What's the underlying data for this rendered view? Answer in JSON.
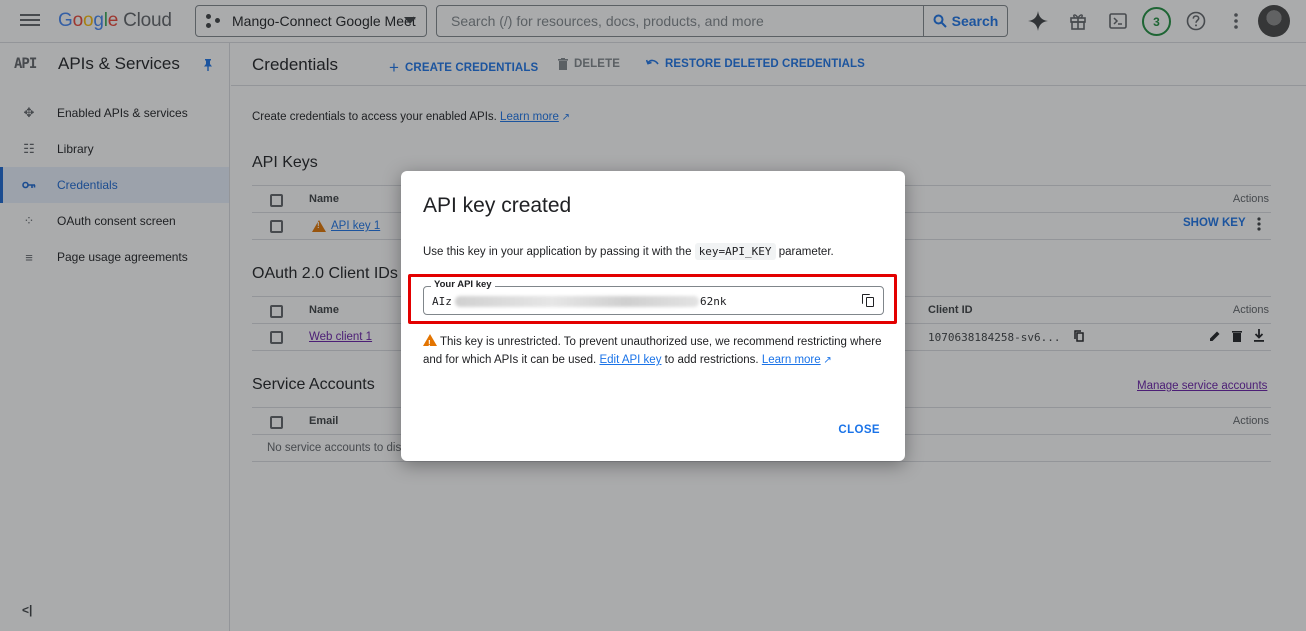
{
  "topbar": {
    "logo_google": "Google",
    "logo_cloud": "Cloud",
    "project_name": "Mango-Connect Google Meet",
    "search_placeholder": "Search (/) for resources, docs, products, and more",
    "search_button": "Search",
    "notifications_count": "3"
  },
  "sidebar": {
    "glyph": "API",
    "title": "APIs & Services",
    "items": [
      {
        "label": "Enabled APIs & services",
        "icon": "hub-icon"
      },
      {
        "label": "Library",
        "icon": "library-icon"
      },
      {
        "label": "Credentials",
        "icon": "key-icon",
        "active": true
      },
      {
        "label": "OAuth consent screen",
        "icon": "consent-icon"
      },
      {
        "label": "Page usage agreements",
        "icon": "settings-list-icon"
      }
    ],
    "collapse_label": "<|"
  },
  "main": {
    "title": "Credentials",
    "actions": {
      "create": "CREATE CREDENTIALS",
      "delete": "DELETE",
      "restore": "RESTORE DELETED CREDENTIALS"
    },
    "intro_text": "Create credentials to access your enabled APIs.",
    "learn_more": "Learn more",
    "api_keys": {
      "title": "API Keys",
      "col_name": "Name",
      "col_actions": "Actions",
      "rows": [
        {
          "name": "API key 1",
          "action": "SHOW KEY"
        }
      ]
    },
    "oauth": {
      "title": "OAuth 2.0 Client IDs",
      "col_name": "Name",
      "col_client_id": "Client ID",
      "col_actions": "Actions",
      "rows": [
        {
          "name": "Web client 1",
          "client_id": "1070638184258-sv6..."
        }
      ]
    },
    "service_accounts": {
      "title": "Service Accounts",
      "manage_link": "Manage service accounts",
      "col_email": "Email",
      "col_actions": "Actions",
      "empty_text": "No service accounts to dis"
    }
  },
  "dialog": {
    "title": "API key created",
    "desc_before": "Use this key in your application by passing it with the",
    "desc_code": "key=API_KEY",
    "desc_after": "parameter.",
    "field_label": "Your API key",
    "key_prefix": "AIz",
    "key_suffix": "62nk",
    "warning_text": "This key is unrestricted. To prevent unauthorized use, we recommend restricting where and for which APIs it can be used.",
    "edit_link": "Edit API key",
    "after_edit": "to add restrictions.",
    "learn_more": "Learn more",
    "close": "CLOSE"
  },
  "colors": {
    "accent": "#1a73e8",
    "highlight": "#e30000",
    "warning": "#e37400"
  }
}
